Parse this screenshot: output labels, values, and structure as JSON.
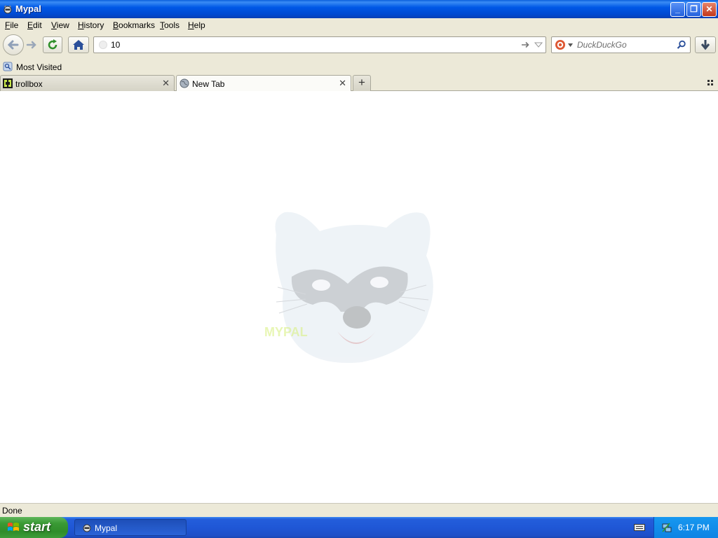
{
  "window": {
    "title": "Mypal",
    "minimize": "_",
    "maximize": "❐",
    "close": "✕"
  },
  "menu": [
    {
      "label": "File",
      "underline": "F",
      "rest": "ile"
    },
    {
      "label": "Edit",
      "underline": "E",
      "rest": "dit"
    },
    {
      "label": "View",
      "underline": "V",
      "rest": "iew"
    },
    {
      "label": "History",
      "underline": "H",
      "rest": "istory"
    },
    {
      "label": "Bookmarks",
      "underline": "B",
      "rest": "ookmarks"
    },
    {
      "label": "Tools",
      "underline": "T",
      "rest": "ools"
    },
    {
      "label": "Help",
      "underline": "H",
      "rest": "elp"
    }
  ],
  "navbar": {
    "url_value": "10",
    "search_engine": "DuckDuckGo",
    "search_placeholder": "DuckDuckGo"
  },
  "bookmarks": {
    "most_visited": "Most Visited"
  },
  "tabs": [
    {
      "label": "trollbox",
      "selected": false
    },
    {
      "label": "New Tab",
      "selected": true
    }
  ],
  "status": {
    "text": "Done"
  },
  "taskbar": {
    "start": "start",
    "task": "Mypal",
    "clock": "6:17 PM"
  },
  "colors": {
    "accent": "#0058e6",
    "start_green": "#3a9a35",
    "logo_yellow": "#d7f07a"
  }
}
